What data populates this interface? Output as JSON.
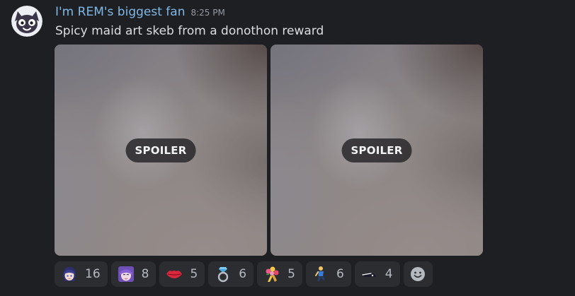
{
  "message": {
    "username": "I'm REM's biggest fan",
    "timestamp": "8:25 PM",
    "content": "Spicy maid art skeb from a donothon reward",
    "username_color": "#7fb8e6"
  },
  "attachments": [
    {
      "spoiler_label": "SPOILER"
    },
    {
      "spoiler_label": "SPOILER"
    }
  ],
  "reactions": [
    {
      "emoji": "anime-girl-blue-hair-emoji",
      "count": "16"
    },
    {
      "emoji": "anime-girl-purple-hair-emoji",
      "count": "8"
    },
    {
      "emoji": "kiss-mark-emoji",
      "count": "5"
    },
    {
      "emoji": "ring-emoji",
      "count": "6"
    },
    {
      "emoji": "bouquet-emoji",
      "count": "5"
    },
    {
      "emoji": "person-kneeling-emoji",
      "count": "6"
    },
    {
      "emoji": "custom-dark-emoji",
      "count": "4"
    }
  ],
  "add_reaction_icon": "smiley-add-reaction-icon"
}
